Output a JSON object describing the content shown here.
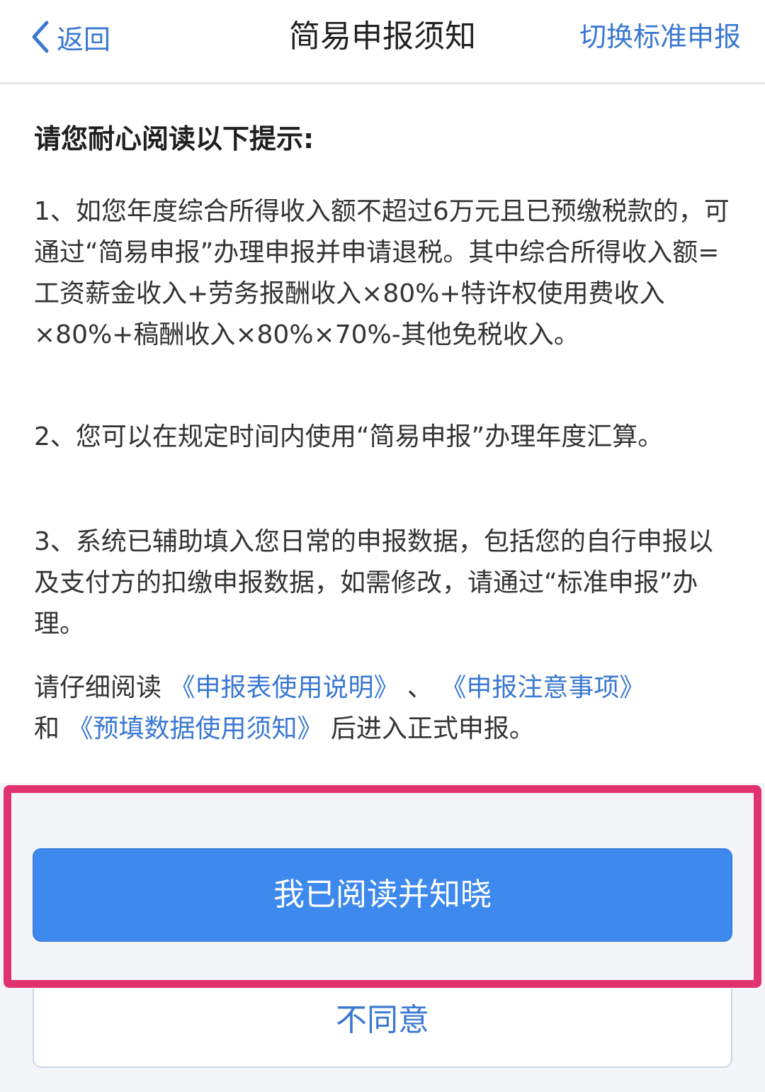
{
  "header": {
    "back_label": "返回",
    "title": "简易申报须知",
    "switch_label": "切换标准申报"
  },
  "content": {
    "intro": "请您耐心阅读以下提示:",
    "paragraphs": [
      "1、如您年度综合所得收入额不超过6万元且已预缴税款的，可通过“简易申报”办理申报并申请退税。其中综合所得收入额=工资薪金收入+劳务报酬收入×80%+特许权使用费收入×80%+稿酬收入×80%×70%-其他免税收入。",
      "2、您可以在规定时间内使用“简易申报”办理年度汇算。",
      "3、系统已辅助填入您日常的申报数据，包括您的自行申报以及支付方的扣缴申报数据，如需修改，请通过“标准申报”办理。"
    ],
    "notice": {
      "prefix": "请仔细阅读 ",
      "link1": "《申报表使用说明》",
      "sep": " 、 ",
      "link2": "《申报注意事项》",
      "and": "和 ",
      "link3": "《预填数据使用须知》",
      "suffix": " 后进入正式申报。"
    }
  },
  "actions": {
    "agree_label": "我已阅读并知晓",
    "disagree_label": "不同意"
  },
  "colors": {
    "accent": "#3a78d2",
    "primary_button": "#3d89ee",
    "highlight_border": "#e0336d"
  },
  "icons": {
    "back": "chevron-left-icon"
  }
}
